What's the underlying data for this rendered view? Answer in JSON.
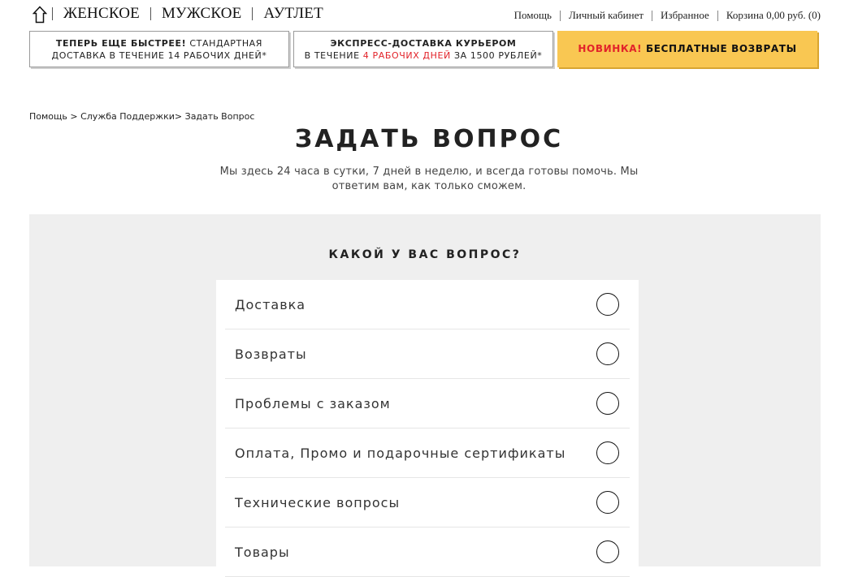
{
  "header": {
    "main_nav": [
      "ЖЕНСКОЕ",
      "МУЖСКОЕ",
      "АУТЛЕТ"
    ],
    "util_nav": [
      "Помощь",
      "Личный кабинет",
      "Избранное",
      "Корзина 0,00 руб. (0)"
    ]
  },
  "promos": {
    "standard": {
      "bold": "Теперь еще быстрее!",
      "rest": " стандартная",
      "line2": "доставка в течение 14 рабочих дней*"
    },
    "express": {
      "line1": "Экспресс-доставка курьером",
      "pre": "в течение ",
      "highlight": "4 рабочих дней",
      "post": " за 1500 рублей*"
    },
    "returns": {
      "highlight": "Новинка!",
      "rest": " Бесплатные возвраты"
    }
  },
  "breadcrumb": {
    "items": [
      "Помощь",
      "Служба Поддержки",
      "Задать Вопрос"
    ],
    "sep1": " > ",
    "sep2": "> "
  },
  "page": {
    "title": "ЗАДАТЬ ВОПРОС",
    "subtitle": "Мы здесь 24 часа в сутки, 7 дней в неделю, и всегда готовы помочь. Мы ответим вам, как только сможем."
  },
  "question": {
    "title": "КАКОЙ У ВАС ВОПРОС?",
    "options": [
      "Доставка",
      "Возвраты",
      "Проблемы с заказом",
      "Оплата, Промо и подарочные сертификаты",
      "Технические вопросы",
      "Товары"
    ]
  },
  "icons": {
    "home": "home-icon",
    "radio": "radio-circle-icon"
  },
  "colors": {
    "accent_red": "#e2232a",
    "promo_yellow": "#f9c752",
    "panel_bg": "#efefef"
  }
}
